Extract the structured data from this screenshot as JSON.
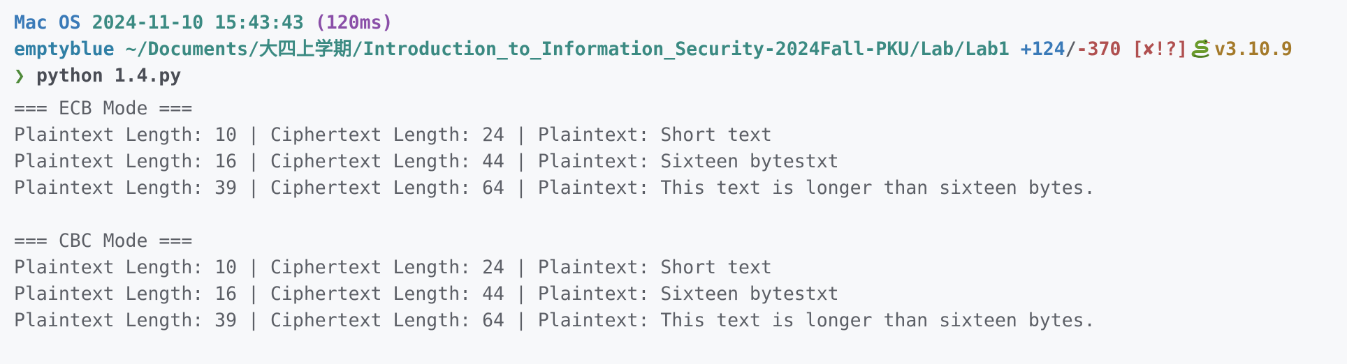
{
  "prompt_header": {
    "os": "Mac OS",
    "datetime": "2024-11-10 15:43:43",
    "duration": "(120ms)"
  },
  "prompt_path": {
    "user": "emptyblue",
    "path": "~/Documents/大四上学期/Introduction_to_Information_Security-2024Fall-PKU/Lab/Lab1",
    "git_added": "+124",
    "git_sep": "/",
    "git_deleted": "-370",
    "git_status": "[✘!?]",
    "python_icon": "snake-icon",
    "python_version": "v3.10.9"
  },
  "command": {
    "prompt_symbol": "❯",
    "text": "python 1.4.py"
  },
  "output": {
    "ecb_header": "=== ECB Mode ===",
    "ecb_lines": [
      "Plaintext Length: 10 | Ciphertext Length: 24 | Plaintext: Short text",
      "Plaintext Length: 16 | Ciphertext Length: 44 | Plaintext: Sixteen bytestxt",
      "Plaintext Length: 39 | Ciphertext Length: 64 | Plaintext: This text is longer than sixteen bytes."
    ],
    "cbc_header": "=== CBC Mode ===",
    "cbc_lines": [
      "Plaintext Length: 10 | Ciphertext Length: 24 | Plaintext: Short text",
      "Plaintext Length: 16 | Ciphertext Length: 44 | Plaintext: Sixteen bytestxt",
      "Plaintext Length: 39 | Ciphertext Length: 64 | Plaintext: This text is longer than sixteen bytes."
    ]
  },
  "colors": {
    "background": "#f7f8fa",
    "os": "#3a7ab8",
    "date": "#3b8a82",
    "duration": "#8a4fa8",
    "git_deleted": "#b05050",
    "python_version": "#a47a2a",
    "prompt": "#4f8a3a"
  }
}
